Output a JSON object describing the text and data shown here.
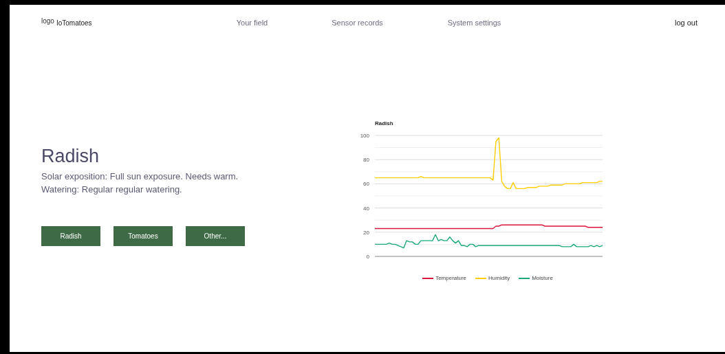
{
  "header": {
    "logo": "logo",
    "brand": "IoTomatoes",
    "nav": [
      {
        "label": "Your field"
      },
      {
        "label": "Sensor records"
      },
      {
        "label": "System settings"
      }
    ],
    "logout": "log out"
  },
  "plant": {
    "title": "Radish",
    "lines": [
      "Solar exposition: Full sun exposure. Needs warm.",
      "Watering: Regular regular watering."
    ]
  },
  "buttons": [
    {
      "label": "Radish"
    },
    {
      "label": "Tomatoes"
    },
    {
      "label": "Other..."
    }
  ],
  "chart": {
    "chart_data": {
      "type": "line",
      "title": "Radish",
      "grid": true,
      "legend": "bottom",
      "ylim": [
        0,
        100
      ],
      "yticks": [
        0,
        20,
        40,
        60,
        80,
        100
      ],
      "series": [
        {
          "name": "Temperature",
          "color": "#dc143c",
          "values": [
            23,
            23,
            23,
            23,
            23,
            23,
            23,
            23,
            23,
            23,
            23,
            23,
            23,
            23,
            23,
            23,
            23,
            23,
            23,
            23,
            23,
            23,
            23,
            23,
            23,
            23,
            23,
            23,
            23,
            23,
            23,
            23,
            23,
            23,
            23,
            23,
            23,
            23,
            23,
            23,
            23,
            23,
            25,
            25,
            26,
            26,
            26,
            26,
            26,
            26,
            26,
            26,
            26,
            26,
            26,
            26,
            26,
            26,
            26,
            25,
            25,
            25,
            25,
            25,
            25,
            25,
            25,
            25,
            25,
            25,
            25,
            25,
            25,
            25,
            24,
            24,
            24,
            24,
            24,
            24
          ]
        },
        {
          "name": "Humidity",
          "color": "#ffcd00",
          "values": [
            65,
            65,
            65,
            65,
            65,
            65,
            65,
            65,
            65,
            65,
            65,
            65,
            65,
            65,
            65,
            65,
            66,
            65,
            65,
            65,
            65,
            65,
            65,
            65,
            65,
            65,
            65,
            65,
            65,
            65,
            65,
            65,
            65,
            65,
            65,
            65,
            65,
            65,
            65,
            65,
            65,
            63,
            95,
            98,
            62,
            58,
            56,
            56,
            61,
            56,
            56,
            56,
            56,
            57,
            57,
            57,
            57,
            58,
            58,
            58,
            58,
            59,
            59,
            59,
            59,
            59,
            60,
            60,
            60,
            60,
            60,
            60,
            61,
            61,
            61,
            61,
            61,
            61,
            62,
            62
          ]
        },
        {
          "name": "Moisture",
          "color": "#1aaa76",
          "values": [
            10,
            10,
            10,
            10,
            10,
            11,
            10,
            10,
            9,
            8,
            7,
            13,
            12,
            12,
            10,
            10,
            13,
            13,
            13,
            13,
            13,
            18,
            13,
            14,
            13,
            13,
            16,
            13,
            11,
            13,
            9,
            9,
            8,
            10,
            10,
            8,
            9,
            9,
            9,
            9,
            9,
            9,
            9,
            9,
            9,
            9,
            9,
            9,
            9,
            9,
            9,
            9,
            9,
            9,
            9,
            9,
            9,
            9,
            9,
            9,
            9,
            9,
            9,
            9,
            9,
            8,
            8,
            8,
            8,
            10,
            8,
            8,
            8,
            8,
            8,
            9,
            8,
            9,
            8,
            9
          ]
        }
      ]
    }
  }
}
